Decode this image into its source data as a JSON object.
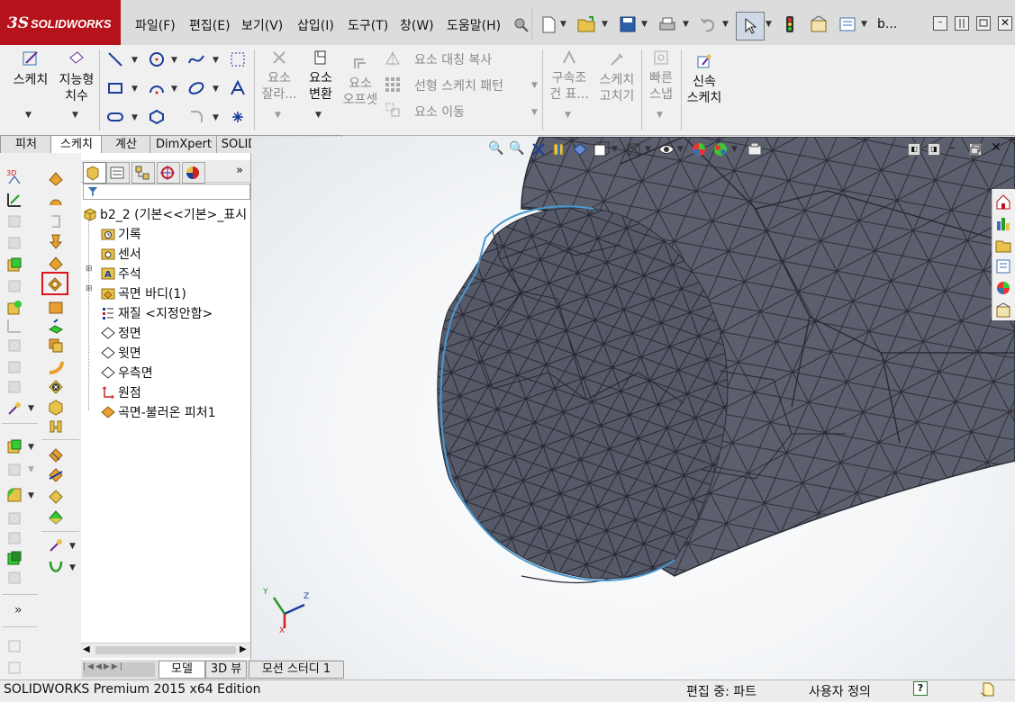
{
  "app": {
    "logo_ds": "3S",
    "logo_text": "SOLIDWORKS"
  },
  "menu": [
    "파일(F)",
    "편집(E)",
    "보기(V)",
    "삽입(I)",
    "도구(T)",
    "창(W)",
    "도움말(H)"
  ],
  "quick_access": {
    "doc_title": "b..."
  },
  "ribbon": {
    "sketch": "스케치",
    "smart_dim_1": "지능형",
    "smart_dim_2": "치수",
    "trim_1": "요소",
    "trim_2": "잘라...",
    "convert_1": "요소",
    "convert_2": "변환",
    "offset_1": "요소",
    "offset_2": "오프셋",
    "mirror": "요소 대칭 복사",
    "linear_pattern": "선형 스케치 패턴",
    "move": "요소 이동",
    "relations_1": "구속조",
    "relations_2": "건 표...",
    "repair_1": "스케치",
    "repair_2": "고치기",
    "quick_snap_1": "빠른",
    "quick_snap_2": "스냅",
    "rapid_sketch_1": "신속",
    "rapid_sketch_2": "스케치"
  },
  "tabs": [
    "피처",
    "스케치",
    "계산",
    "DimXpert",
    "SOLIDWORKS 애드인"
  ],
  "active_tab": "스케치",
  "tree": {
    "root": "b2_2  (기본<<기본>_표시",
    "items": [
      {
        "label": "기록",
        "icon": "history-icon",
        "expandable": false
      },
      {
        "label": "센서",
        "icon": "sensor-icon",
        "expandable": false
      },
      {
        "label": "주석",
        "icon": "annotation-icon",
        "expandable": true
      },
      {
        "label": "곡면 바디(1)",
        "icon": "surface-body-icon",
        "expandable": true
      },
      {
        "label": "재질 <지정안함>",
        "icon": "material-icon",
        "expandable": false
      },
      {
        "label": "정면",
        "icon": "plane-icon",
        "expandable": false
      },
      {
        "label": "윗면",
        "icon": "plane-icon",
        "expandable": false
      },
      {
        "label": "우측면",
        "icon": "plane-icon",
        "expandable": false
      },
      {
        "label": "원점",
        "icon": "origin-icon",
        "expandable": false
      },
      {
        "label": "곡면-불러온 피처1",
        "icon": "imported-surface-icon",
        "expandable": false
      }
    ]
  },
  "triad": {
    "y": "Y",
    "z": "Z",
    "x": "X"
  },
  "bottom_tabs": [
    "모델",
    "3D 뷰",
    "모션 스터디 1"
  ],
  "status": {
    "edition": "SOLIDWORKS Premium 2015 x64 Edition",
    "editing": "편집 중: 파트",
    "units": "사용자 정의"
  },
  "colors": {
    "logo_red": "#b5121b",
    "mesh_face": "#5e6170",
    "mesh_edge": "#2a2c36",
    "highlight_edge": "#4a9ad0",
    "highlight_box": "#e0141e"
  }
}
